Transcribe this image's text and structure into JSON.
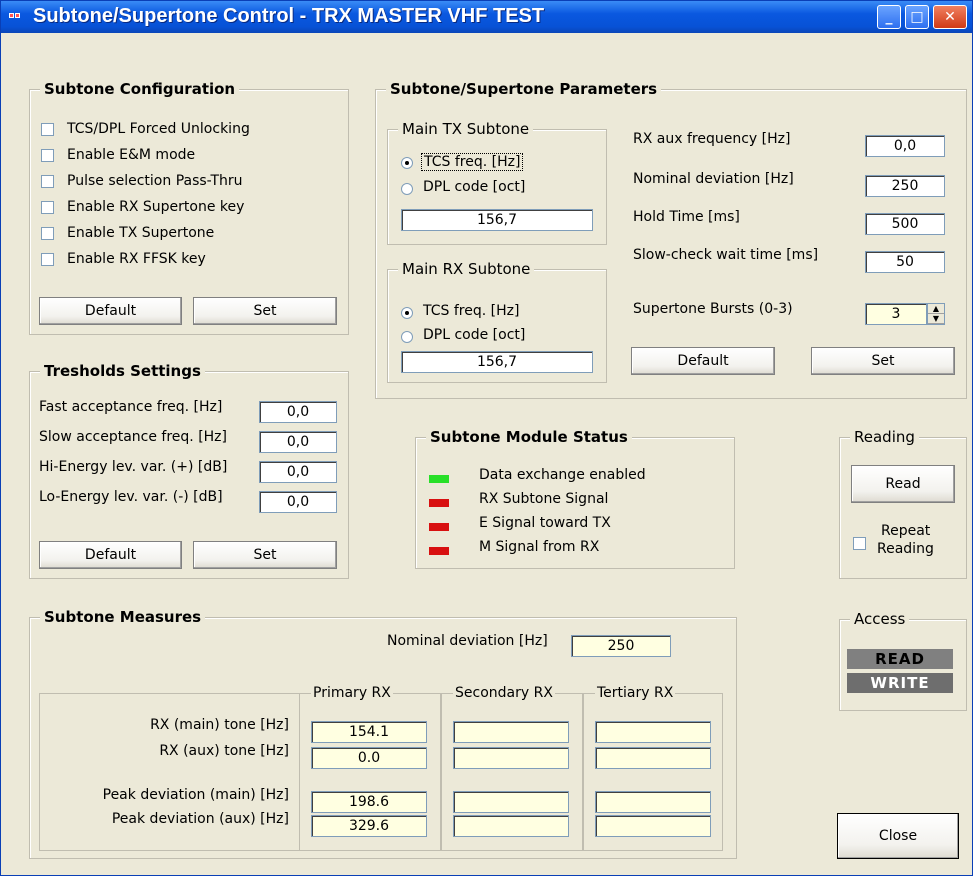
{
  "window": {
    "title": "Subtone/Supertone Control - TRX MASTER VHF TEST"
  },
  "subtone_config": {
    "legend": "Subtone Configuration",
    "options": [
      "TCS/DPL Forced Unlocking",
      "Enable E&M mode",
      "Pulse selection Pass-Thru",
      "Enable RX Supertone key",
      "Enable TX Supertone",
      "Enable RX FFSK key"
    ],
    "default_label": "Default",
    "set_label": "Set"
  },
  "params": {
    "legend": "Subtone/Supertone Parameters",
    "main_tx": {
      "legend": "Main TX Subtone",
      "tcs_label": "TCS freq. [Hz]",
      "dpl_label": "DPL code [oct]",
      "value": "156,7"
    },
    "main_rx": {
      "legend": "Main RX Subtone",
      "tcs_label": "TCS freq. [Hz]",
      "dpl_label": "DPL code [oct]",
      "value": "156,7"
    },
    "fields": [
      {
        "label": "RX aux frequency [Hz]",
        "value": "0,0"
      },
      {
        "label": "Nominal deviation [Hz]",
        "value": "250"
      },
      {
        "label": "Hold Time [ms]",
        "value": "500"
      },
      {
        "label": "Slow-check wait time [ms]",
        "value": "50"
      }
    ],
    "bursts": {
      "label": "Supertone Bursts (0-3)",
      "value": "3"
    },
    "default_label": "Default",
    "set_label": "Set"
  },
  "thresholds": {
    "legend": "Tresholds Settings",
    "fields": [
      {
        "label": "Fast acceptance freq. [Hz]",
        "value": "0,0"
      },
      {
        "label": "Slow acceptance freq. [Hz]",
        "value": "0,0"
      },
      {
        "label": "Hi-Energy lev. var. (+) [dB]",
        "value": "0,0"
      },
      {
        "label": "Lo-Energy lev. var. (-) [dB]",
        "value": "0,0"
      }
    ],
    "default_label": "Default",
    "set_label": "Set"
  },
  "status": {
    "legend": "Subtone Module Status",
    "items": [
      {
        "label": "Data exchange enabled",
        "color": "#28e028"
      },
      {
        "label": "RX Subtone Signal",
        "color": "#d81010"
      },
      {
        "label": "E Signal toward TX",
        "color": "#d81010"
      },
      {
        "label": "M Signal from RX",
        "color": "#d81010"
      }
    ]
  },
  "reading": {
    "legend": "Reading",
    "read_label": "Read",
    "repeat_label_1": "Repeat",
    "repeat_label_2": "Reading"
  },
  "access": {
    "legend": "Access",
    "read": "READ",
    "write": "WRITE"
  },
  "measures": {
    "legend": "Subtone Measures",
    "nominal_label": "Nominal deviation [Hz]",
    "nominal_value": "250",
    "columns": [
      "Primary RX",
      "Secondary RX",
      "Tertiary RX"
    ],
    "rows": [
      {
        "label": "RX (main) tone [Hz]",
        "values": [
          "154.1",
          "",
          ""
        ]
      },
      {
        "label": "RX (aux) tone [Hz]",
        "values": [
          "0.0",
          "",
          ""
        ]
      },
      {
        "label": "Peak deviation (main) [Hz]",
        "values": [
          "198.6",
          "",
          ""
        ]
      },
      {
        "label": "Peak deviation (aux) [Hz]",
        "values": [
          "329.6",
          "",
          ""
        ]
      }
    ]
  },
  "close_label": "Close"
}
